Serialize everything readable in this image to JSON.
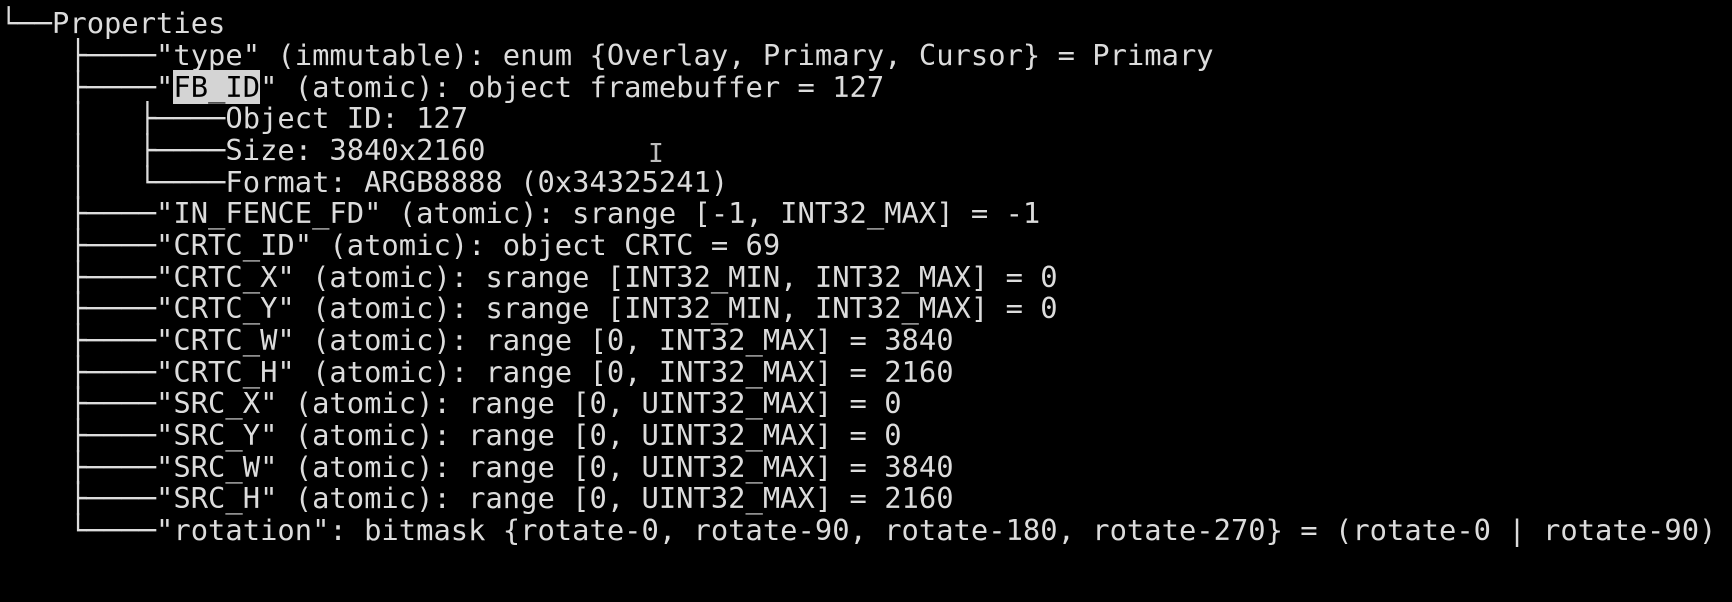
{
  "terminal": {
    "lines": [
      {
        "prefix": "└──",
        "text": "Properties"
      },
      {
        "prefix": "    ├────",
        "text": "\"type\" (immutable): enum {Overlay, Primary, Cursor} = Primary"
      },
      {
        "prefix": "    ├────",
        "pre": "\"",
        "highlight": "FB_ID",
        "text": "\" (atomic): object framebuffer = 127"
      },
      {
        "prefix": "    │   ├────",
        "text": "Object ID: 127"
      },
      {
        "prefix": "    │   ├────",
        "text": "Size: 3840x2160"
      },
      {
        "prefix": "    │   └────",
        "text": "Format: ARGB8888 (0x34325241)"
      },
      {
        "prefix": "    ├────",
        "text": "\"IN_FENCE_FD\" (atomic): srange [-1, INT32_MAX] = -1"
      },
      {
        "prefix": "    ├────",
        "text": "\"CRTC_ID\" (atomic): object CRTC = 69"
      },
      {
        "prefix": "    ├────",
        "text": "\"CRTC_X\" (atomic): srange [INT32_MIN, INT32_MAX] = 0"
      },
      {
        "prefix": "    ├────",
        "text": "\"CRTC_Y\" (atomic): srange [INT32_MIN, INT32_MAX] = 0"
      },
      {
        "prefix": "    ├────",
        "text": "\"CRTC_W\" (atomic): range [0, INT32_MAX] = 3840"
      },
      {
        "prefix": "    ├────",
        "text": "\"CRTC_H\" (atomic): range [0, INT32_MAX] = 2160"
      },
      {
        "prefix": "    ├────",
        "text": "\"SRC_X\" (atomic): range [0, UINT32_MAX] = 0"
      },
      {
        "prefix": "    ├────",
        "text": "\"SRC_Y\" (atomic): range [0, UINT32_MAX] = 0"
      },
      {
        "prefix": "    ├────",
        "text": "\"SRC_W\" (atomic): range [0, UINT32_MAX] = 3840"
      },
      {
        "prefix": "    ├────",
        "text": "\"SRC_H\" (atomic): range [0, UINT32_MAX] = 2160"
      },
      {
        "prefix": "    └────",
        "text": "\"rotation\": bitmask {rotate-0, rotate-90, rotate-180, rotate-270} = (rotate-0 | rotate-90)"
      }
    ],
    "cursor_glyph": "I",
    "colors": {
      "background": "#000000",
      "foreground": "#dcdcdc",
      "selection_bg": "#d4d4d4",
      "selection_fg": "#000000"
    }
  }
}
